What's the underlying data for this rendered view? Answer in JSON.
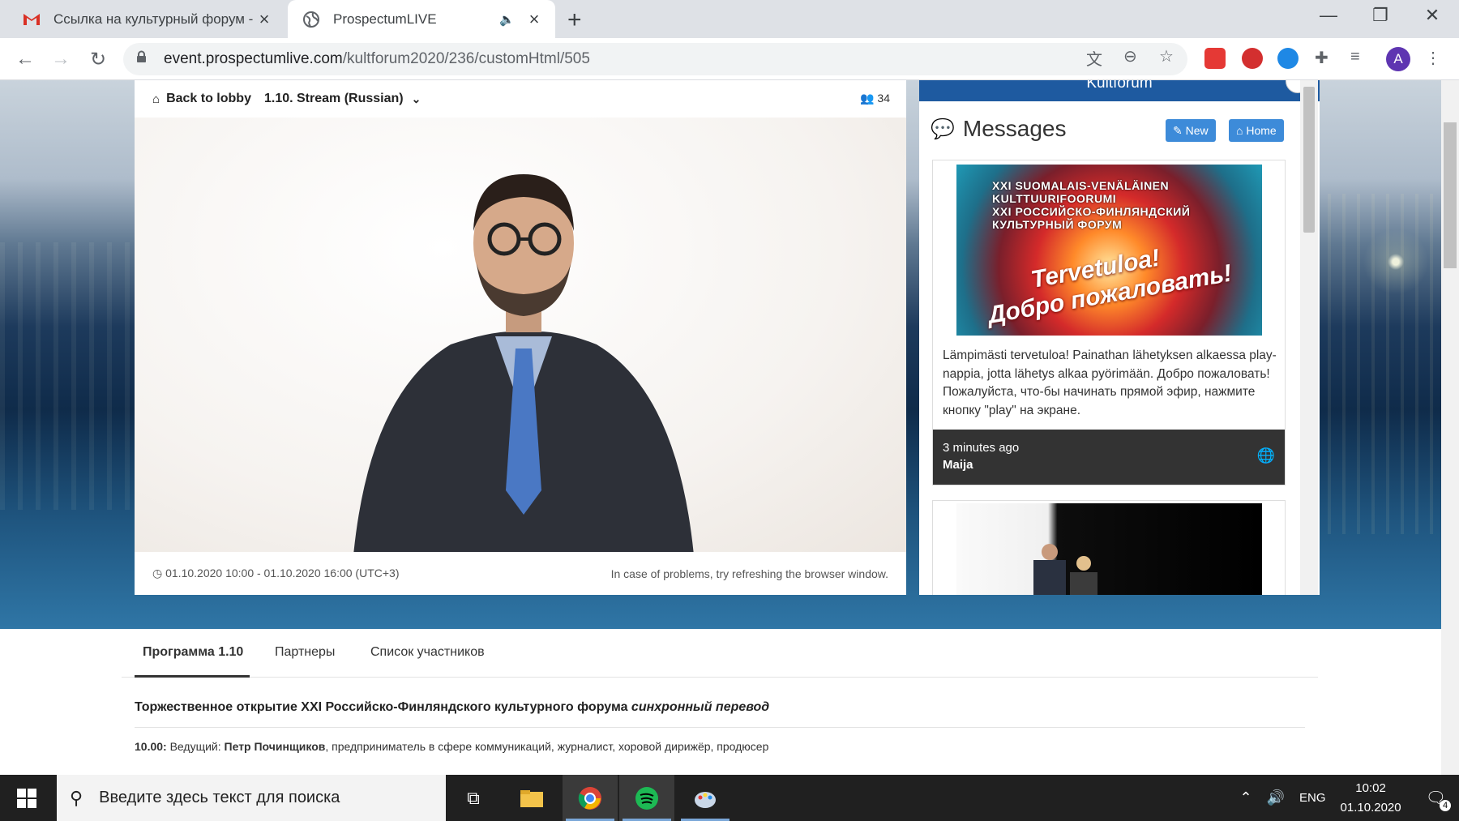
{
  "browser": {
    "tabs": [
      {
        "title": "Ссылка на культурный форум -",
        "favicon": "gmail-icon",
        "active": false
      },
      {
        "title": "ProspectumLIVE",
        "favicon": "globe-icon",
        "active": true
      }
    ],
    "url_host": "event.prospectumlive.com",
    "url_path": "/kultforum2020/236/customHtml/505"
  },
  "player": {
    "back_label": "Back to lobby",
    "stream_name": "1.10. Stream (Russian)",
    "viewer_count": "34",
    "schedule": "01.10.2020 10:00 - 01.10.2020 16:00 (UTC+3)",
    "problem_hint": "In case of problems, try refreshing the browser window."
  },
  "sidebar": {
    "brand": "Kultforum",
    "heading": "Messages",
    "new_label": "New",
    "home_label": "Home",
    "messages": [
      {
        "banner_lines": [
          "XXI SUOMALAIS-VENÄLÄINEN",
          "KULTTUURIFOORUMI",
          "XXI РОССИЙСКО-ФИНЛЯНДСКИЙ",
          "КУЛЬТУРНЫЙ ФОРУМ"
        ],
        "banner_welcome": [
          "Tervetuloa!",
          "Добро пожаловать!"
        ],
        "text": "Lämpimästi tervetuloa! Painathan lähetyksen alkaessa play-nappia, jotta lähetys alkaa pyörimään. Добро пожаловать! Пожалуйста, что-бы начинать прямой эфир, нажмите кнопку \"play\" на экране.",
        "time": "3 minutes ago",
        "author": "Maija"
      }
    ]
  },
  "page_tabs": [
    "Программа 1.10",
    "Партнеры",
    "Список участников"
  ],
  "program": {
    "title": "Торжественное открытие XXI Российско-Финляндского культурного форума",
    "title_italic": "синхронный перевод",
    "time": "10.00:",
    "host_label": "Ведущий:",
    "host_name": "Петр Починщиков",
    "host_desc": ", предприниматель в сфере коммуникаций, журналист, хоровой дирижёр, продюсер"
  },
  "taskbar": {
    "search_placeholder": "Введите здесь текст для поиска",
    "lang": "ENG",
    "time": "10:02",
    "date": "01.10.2020",
    "notifications": "4"
  },
  "colors": {
    "brand_blue": "#1e5aa0",
    "button_blue": "#3d8bd9",
    "card_footer": "#333333"
  }
}
